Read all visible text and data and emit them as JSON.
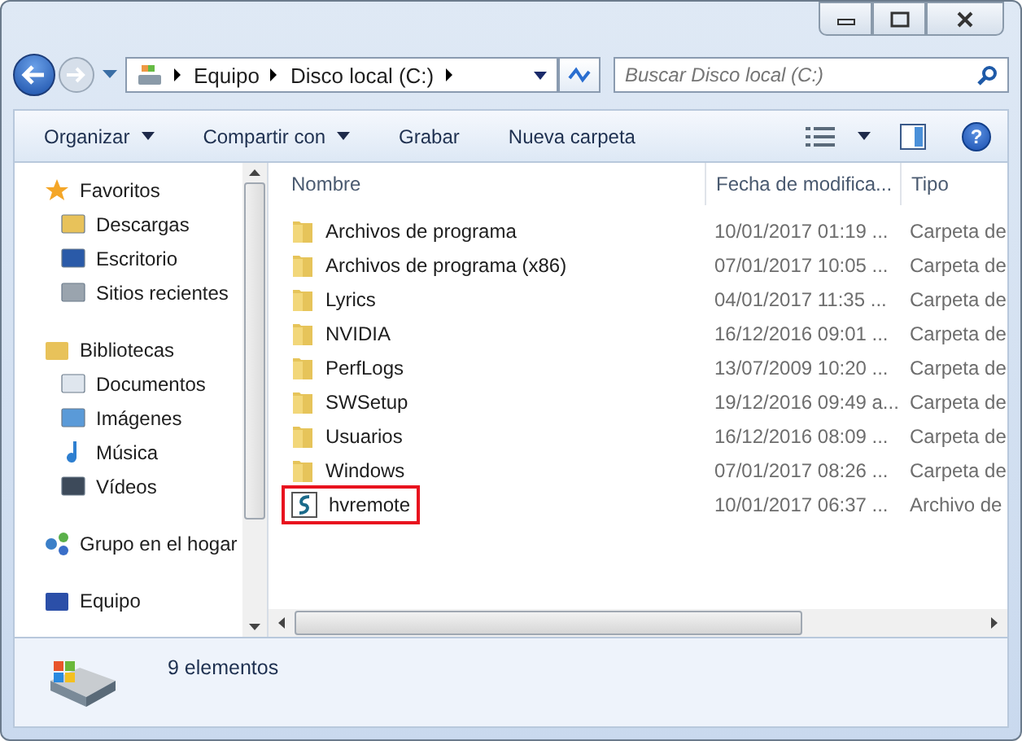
{
  "address": {
    "crumbs": [
      "Equipo",
      "Disco local (C:)"
    ]
  },
  "search": {
    "placeholder": "Buscar Disco local (C:)"
  },
  "toolbar": [
    {
      "label": "Organizar",
      "dropdown": true
    },
    {
      "label": "Compartir con",
      "dropdown": true
    },
    {
      "label": "Grabar",
      "dropdown": false
    },
    {
      "label": "Nueva carpeta",
      "dropdown": false
    }
  ],
  "help_button": "?",
  "sidebar": {
    "groups": [
      {
        "label": "Favoritos",
        "children": [
          {
            "label": "Descargas"
          },
          {
            "label": "Escritorio"
          },
          {
            "label": "Sitios recientes"
          }
        ]
      },
      {
        "label": "Bibliotecas",
        "children": [
          {
            "label": "Documentos"
          },
          {
            "label": "Imágenes"
          },
          {
            "label": "Música"
          },
          {
            "label": "Vídeos"
          }
        ]
      },
      {
        "label": "Grupo en el hogar"
      },
      {
        "label": "Equipo"
      }
    ]
  },
  "table": {
    "columns": [
      "Nombre",
      "Fecha de modifica...",
      "Tipo"
    ],
    "rows": [
      {
        "name": "Archivos de programa",
        "date": "10/01/2017 01:19 ...",
        "type": "Carpeta de",
        "kind": "folder",
        "highlighted": false
      },
      {
        "name": "Archivos de programa (x86)",
        "date": "07/01/2017 10:05 ...",
        "type": "Carpeta de",
        "kind": "folder",
        "highlighted": false
      },
      {
        "name": "Lyrics",
        "date": "04/01/2017 11:35 ...",
        "type": "Carpeta de",
        "kind": "folder",
        "highlighted": false
      },
      {
        "name": "NVIDIA",
        "date": "16/12/2016 09:01 ...",
        "type": "Carpeta de",
        "kind": "folder",
        "highlighted": false
      },
      {
        "name": "PerfLogs",
        "date": "13/07/2009 10:20 ...",
        "type": "Carpeta de",
        "kind": "folder",
        "highlighted": false
      },
      {
        "name": "SWSetup",
        "date": "19/12/2016 09:49 a...",
        "type": "Carpeta de",
        "kind": "folder",
        "highlighted": false
      },
      {
        "name": "Usuarios",
        "date": "16/12/2016 08:09 ...",
        "type": "Carpeta de",
        "kind": "folder",
        "highlighted": false
      },
      {
        "name": "Windows",
        "date": "07/01/2017 08:26 ...",
        "type": "Carpeta de",
        "kind": "folder",
        "highlighted": false
      },
      {
        "name": "hvremote",
        "date": "10/01/2017 06:37 ...",
        "type": "Archivo de",
        "kind": "script",
        "highlighted": true
      }
    ]
  },
  "status_bar": {
    "text": "9 elementos"
  }
}
